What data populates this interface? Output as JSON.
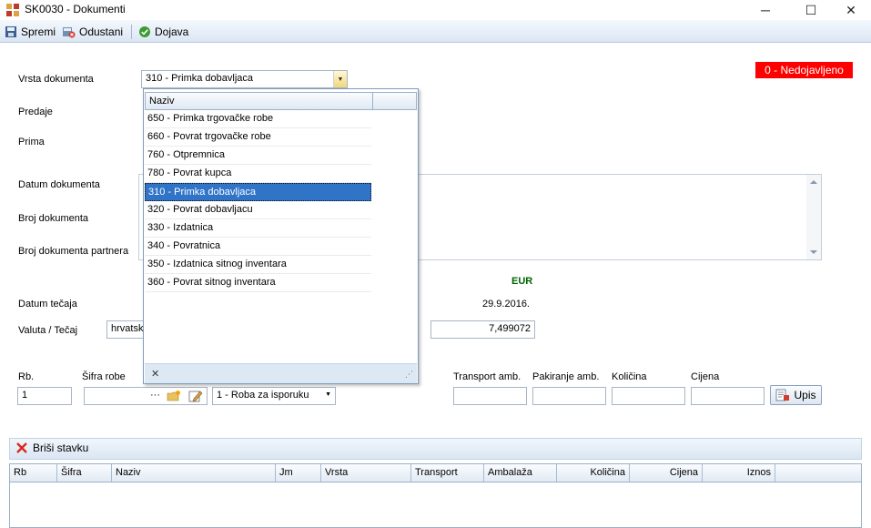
{
  "window": {
    "title": "SK0030 - Dokumenti",
    "minimize_glyph": "─",
    "maximize_glyph": "☐",
    "close_glyph": "✕"
  },
  "toolbar": {
    "save_label": "Spremi",
    "cancel_label": "Odustani",
    "report_label": "Dojava"
  },
  "status_badge": "0 - Nedojavljeno",
  "form": {
    "vrsta_label": "Vrsta dokumenta",
    "vrsta_value": "310 - Primka dobavljaca",
    "predaje_label": "Predaje",
    "prima_label": "Prima",
    "datum_dok_label": "Datum dokumenta",
    "broj_dok_label": "Broj dokumenta",
    "broj_partnera_label": "Broj dokumenta partnera",
    "datum_tecaja_label": "Datum tečaja",
    "valuta_label": "Valuta / Tečaj",
    "valuta_value": "hrvatsk",
    "currency": "EUR",
    "rate_date": "29.9.2016.",
    "rate_value": "7,499072"
  },
  "dropdown": {
    "header": "Naziv",
    "items": [
      "650 - Primka trgovačke robe",
      "660 - Povrat trgovačke robe",
      "760 - Otpremnica",
      "780 - Povrat kupca",
      "310 - Primka dobavljaca",
      "320 - Povrat dobavljacu",
      "330 - Izdatnica",
      "340 - Povratnica",
      "350 - Izdatnica sitnog inventara",
      "360 - Povrat sitnog inventara"
    ],
    "selected_index": 4,
    "close_glyph": "✕",
    "grip_glyph": "⋰"
  },
  "entry": {
    "rb_label": "Rb.",
    "rb_value": "1",
    "sifra_label": "Šifra robe",
    "sifra_dots": "···",
    "roba_value": "1 - Roba za isporuku",
    "transport_label": "Transport amb.",
    "pakiranje_label": "Pakiranje amb.",
    "kolicina_label": "Količina",
    "cijena_label": "Cijena",
    "upis_label": "Upis"
  },
  "grid": {
    "delete_label": "Briši stavku",
    "columns": [
      "Rb",
      "Šifra",
      "Naziv",
      "Jm",
      "Vrsta",
      "Transport",
      "Ambalaža",
      "Količina",
      "Cijena",
      "Iznos"
    ]
  },
  "colors": {
    "badge": "#ff0000",
    "currency": "#006400",
    "selected": "#3074c8"
  }
}
